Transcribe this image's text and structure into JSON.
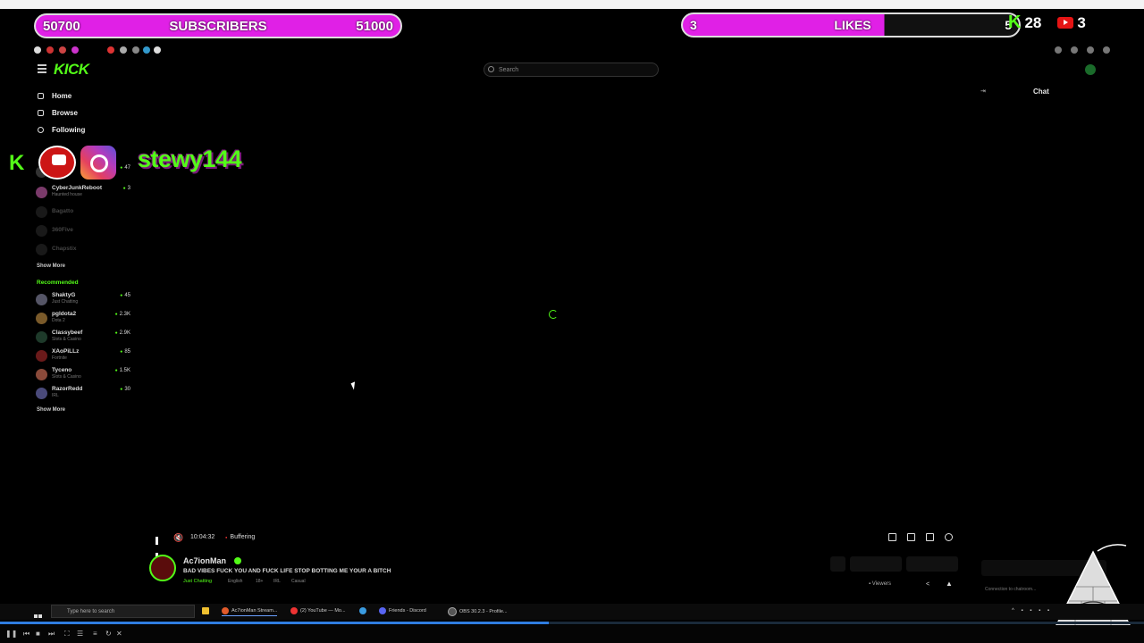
{
  "overlay": {
    "subscribers": {
      "current": "50700",
      "label": "SUBSCRIBERS",
      "goal": "51000"
    },
    "likes": {
      "current": "3",
      "label": "LIKES",
      "goal": "5",
      "progress": 0.6
    },
    "kick_count": "28",
    "youtube_count": "3",
    "social_handle": "stewy144"
  },
  "header": {
    "logo": "KICK",
    "search_placeholder": "Search",
    "chat_label": "Chat"
  },
  "sidebar": {
    "nav": [
      {
        "label": "Home",
        "icon": "home-icon"
      },
      {
        "label": "Browse",
        "icon": "browse-icon"
      },
      {
        "label": "Following",
        "icon": "heart-icon"
      }
    ],
    "following": [
      {
        "name": "CyberJunkReboot",
        "category": "Haunted house",
        "viewers": "3",
        "dim": false
      },
      {
        "name": "Bagatto",
        "category": "",
        "viewers": "",
        "dim": true
      },
      {
        "name": "360Five",
        "category": "",
        "viewers": "",
        "dim": true
      },
      {
        "name": "Chapstix",
        "category": "",
        "viewers": "",
        "dim": true
      }
    ],
    "partial_viewers": "47",
    "show_more": "Show More",
    "recommended_title": "Recommended",
    "recommended": [
      {
        "name": "ShaktyG",
        "category": "Just Chatting",
        "viewers": "45"
      },
      {
        "name": "pgldota2",
        "category": "Dota 2",
        "viewers": "2.3K"
      },
      {
        "name": "Classybeef",
        "category": "Slots & Casino",
        "viewers": "2.9K"
      },
      {
        "name": "XAoPiLLz",
        "category": "Fortnite",
        "viewers": "85"
      },
      {
        "name": "Tyceno",
        "category": "Slots & Casino",
        "viewers": "1.5K"
      },
      {
        "name": "RazorRedd",
        "category": "IRL",
        "viewers": "30"
      }
    ],
    "show_more_2": "Show More"
  },
  "player": {
    "time": "10:04:32",
    "status": "Buffering"
  },
  "stream": {
    "streamer": "Ac7ionMan",
    "title": "BAD VIBES FUCK YOU AND FUCK LIFE STOP BOTTING ME YOUR A BITCH",
    "category": "Just Chatting",
    "tags": [
      "English",
      "18+",
      "IRL",
      "Casual"
    ],
    "viewers_label": "Viewers"
  },
  "chat": {
    "connection_msg": "Connection to chatroom..."
  },
  "taskbar": {
    "search_placeholder": "Type here to search",
    "apps": [
      {
        "label": "Ac7ionMan Stream...",
        "color": "#e25b2b",
        "active": true
      },
      {
        "label": "(2) YouTube — Mo...",
        "color": "#e33",
        "active": false
      },
      {
        "label": "Friends - Discord",
        "color": "#5865f2",
        "active": false
      },
      {
        "label": "OBS 30.2.3 - Profile...",
        "color": "#555",
        "active": false
      }
    ]
  },
  "video_progress": 0.48
}
